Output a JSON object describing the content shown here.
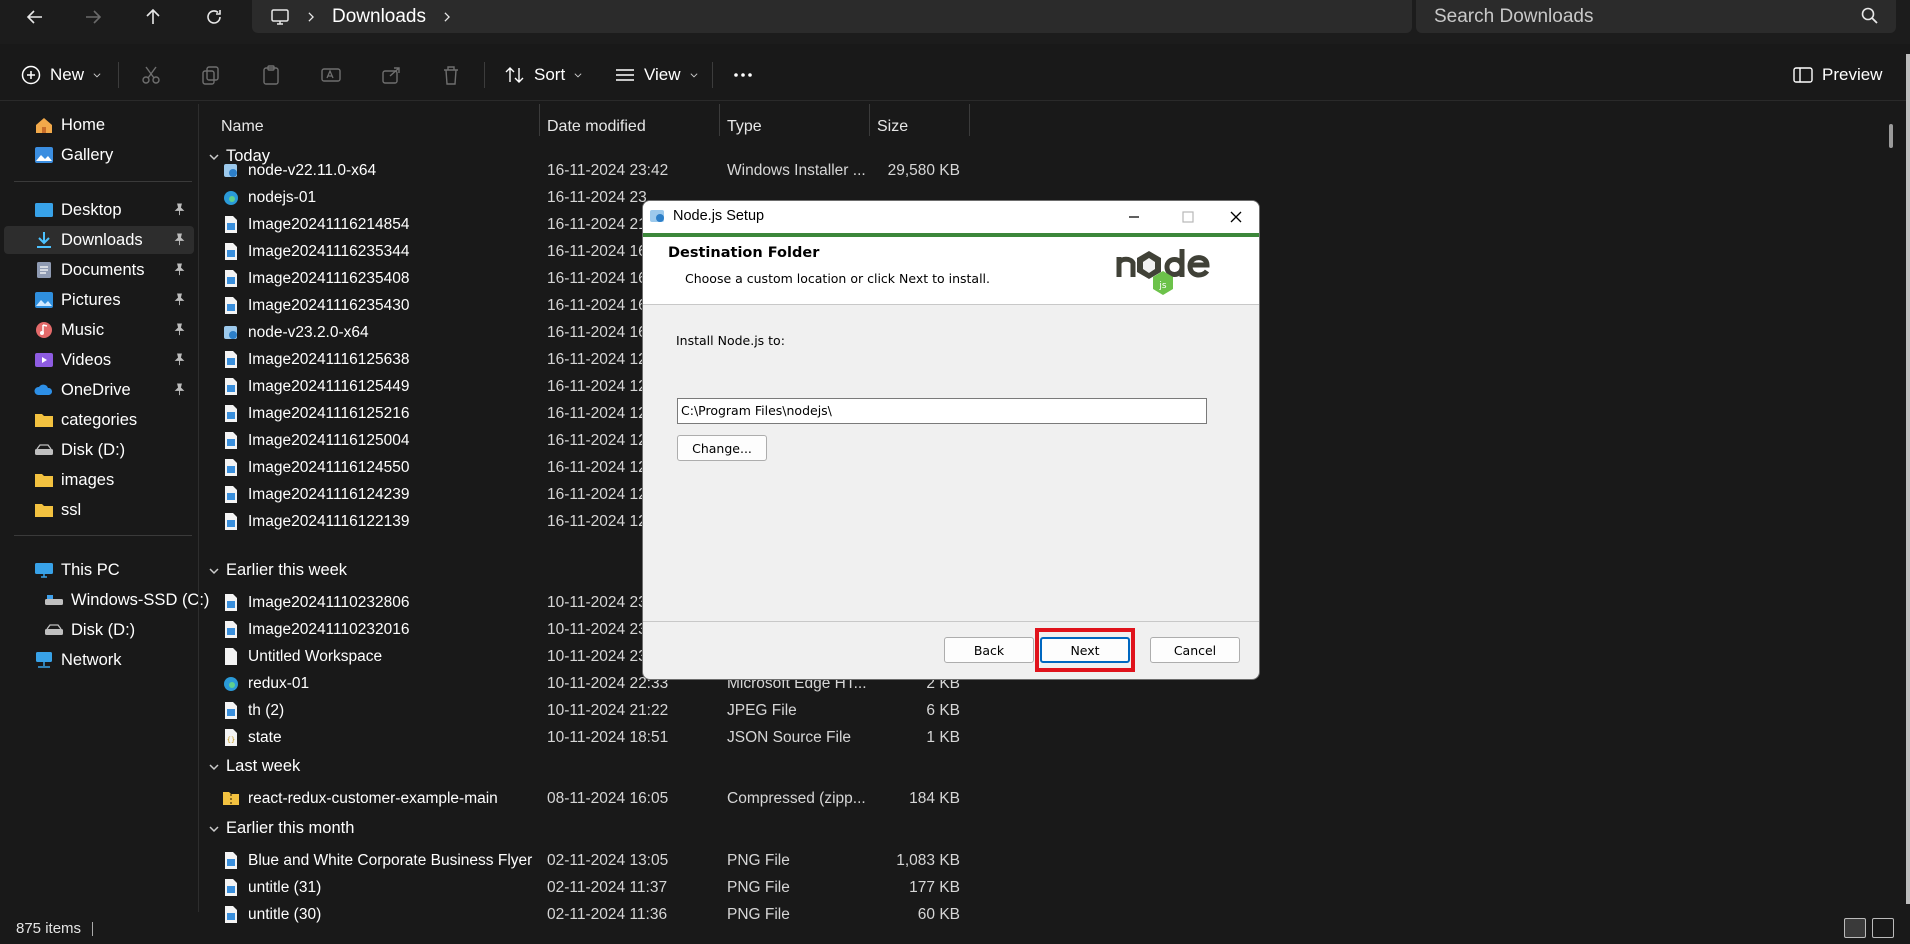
{
  "explorer": {
    "breadcrumb": [
      "Downloads"
    ],
    "search_placeholder": "Search Downloads",
    "toolbar": {
      "new_label": "New",
      "sort_label": "Sort",
      "view_label": "View",
      "preview_label": "Preview"
    },
    "sidebar": {
      "items": [
        {
          "label": "Home"
        },
        {
          "label": "Gallery"
        },
        {
          "label": "Desktop"
        },
        {
          "label": "Downloads"
        },
        {
          "label": "Documents"
        },
        {
          "label": "Pictures"
        },
        {
          "label": "Music"
        },
        {
          "label": "Videos"
        },
        {
          "label": "OneDrive"
        },
        {
          "label": "categories"
        },
        {
          "label": "Disk (D:)"
        },
        {
          "label": "images"
        },
        {
          "label": "ssl"
        },
        {
          "label": "This PC"
        },
        {
          "label": "Windows-SSD (C:)"
        },
        {
          "label": "Disk (D:)"
        },
        {
          "label": "Network"
        }
      ]
    },
    "columns": {
      "name": "Name",
      "date": "Date modified",
      "type": "Type",
      "size": "Size"
    },
    "groups": {
      "today": "Today",
      "earlier_week": "Earlier this week",
      "last_week": "Last week",
      "earlier_month": "Earlier this month"
    },
    "rows": [
      {
        "name": "node-v22.11.0-x64",
        "date": "16-11-2024 23:42",
        "type": "Windows Installer ...",
        "size": "29,580 KB"
      },
      {
        "name": "nodejs-01",
        "date": "16-11-2024 23",
        "type": "",
        "size": ""
      },
      {
        "name": "Image20241116214854",
        "date": "16-11-2024 21",
        "type": "",
        "size": ""
      },
      {
        "name": "Image20241116235344",
        "date": "16-11-2024 16",
        "type": "",
        "size": ""
      },
      {
        "name": "Image20241116235408",
        "date": "16-11-2024 16",
        "type": "",
        "size": ""
      },
      {
        "name": "Image20241116235430",
        "date": "16-11-2024 16",
        "type": "",
        "size": ""
      },
      {
        "name": "node-v23.2.0-x64",
        "date": "16-11-2024 16",
        "type": "",
        "size": ""
      },
      {
        "name": "Image20241116125638",
        "date": "16-11-2024 12",
        "type": "",
        "size": ""
      },
      {
        "name": "Image20241116125449",
        "date": "16-11-2024 12",
        "type": "",
        "size": ""
      },
      {
        "name": "Image20241116125216",
        "date": "16-11-2024 12",
        "type": "",
        "size": ""
      },
      {
        "name": "Image20241116125004",
        "date": "16-11-2024 12",
        "type": "",
        "size": ""
      },
      {
        "name": "Image20241116124550",
        "date": "16-11-2024 12",
        "type": "",
        "size": ""
      },
      {
        "name": "Image20241116124239",
        "date": "16-11-2024 12",
        "type": "",
        "size": ""
      },
      {
        "name": "Image20241116122139",
        "date": "16-11-2024 12",
        "type": "",
        "size": ""
      },
      {
        "name": "Image20241110232806",
        "date": "10-11-2024 23",
        "type": "",
        "size": ""
      },
      {
        "name": "Image20241110232016",
        "date": "10-11-2024 23",
        "type": "",
        "size": ""
      },
      {
        "name": "Untitled Workspace",
        "date": "10-11-2024 23",
        "type": "",
        "size": ""
      },
      {
        "name": "redux-01",
        "date": "10-11-2024 22:33",
        "type": "Microsoft Edge HT...",
        "size": "2 KB"
      },
      {
        "name": "th (2)",
        "date": "10-11-2024 21:22",
        "type": "JPEG File",
        "size": "6 KB"
      },
      {
        "name": "state",
        "date": "10-11-2024 18:51",
        "type": "JSON Source File",
        "size": "1 KB"
      },
      {
        "name": "react-redux-customer-example-main",
        "date": "08-11-2024 16:05",
        "type": "Compressed (zipp...",
        "size": "184 KB"
      },
      {
        "name": "Blue and White Corporate Business Flyer",
        "date": "02-11-2024 13:05",
        "type": "PNG File",
        "size": "1,083 KB"
      },
      {
        "name": "untitle (31)",
        "date": "02-11-2024 11:37",
        "type": "PNG File",
        "size": "177 KB"
      },
      {
        "name": "untitle (30)",
        "date": "02-11-2024 11:36",
        "type": "PNG File",
        "size": "60 KB"
      }
    ],
    "status": {
      "item_count": "875 items"
    }
  },
  "dialog": {
    "title": "Node.js Setup",
    "heading": "Destination Folder",
    "subheading": "Choose a custom location or click Next to install.",
    "install_label": "Install Node.js to:",
    "path_value": "C:\\Program Files\\nodejs\\",
    "change_label": "Change...",
    "back_label": "Back",
    "next_label": "Next",
    "cancel_label": "Cancel"
  }
}
